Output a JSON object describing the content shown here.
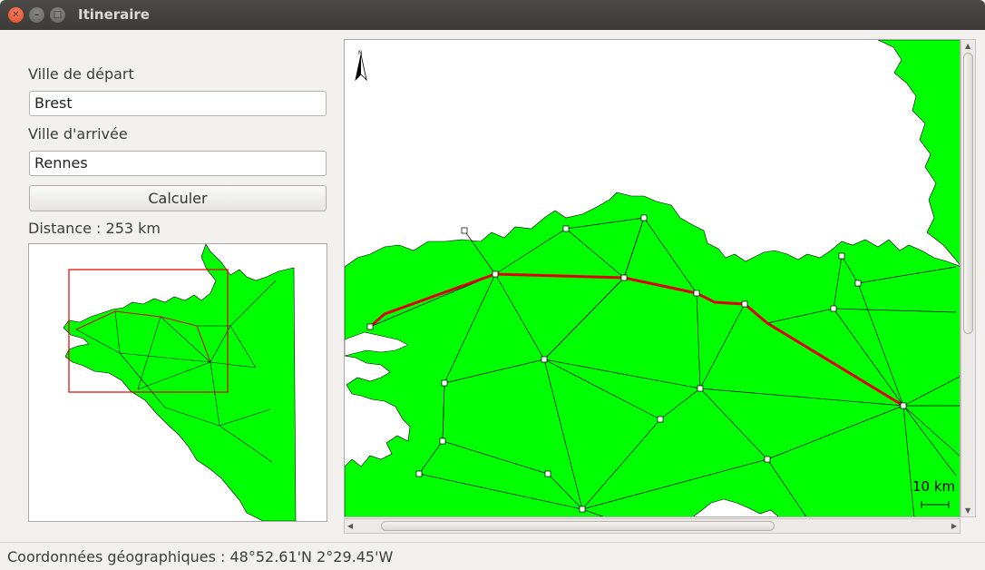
{
  "window": {
    "title": "Itineraire"
  },
  "form": {
    "start_label": "Ville de départ",
    "start_value": "Brest",
    "end_label": "Ville d'arrivée",
    "end_value": "Rennes",
    "calc_label": "Calculer",
    "distance_text": "Distance : 253 km"
  },
  "map": {
    "scale_label": "10 km",
    "north_label": "N",
    "land_color": "#00ff00",
    "route_color": "#e00000"
  },
  "status": {
    "text": "Coordonnées géographiques : 48°52.61'N 2°29.45'W"
  }
}
